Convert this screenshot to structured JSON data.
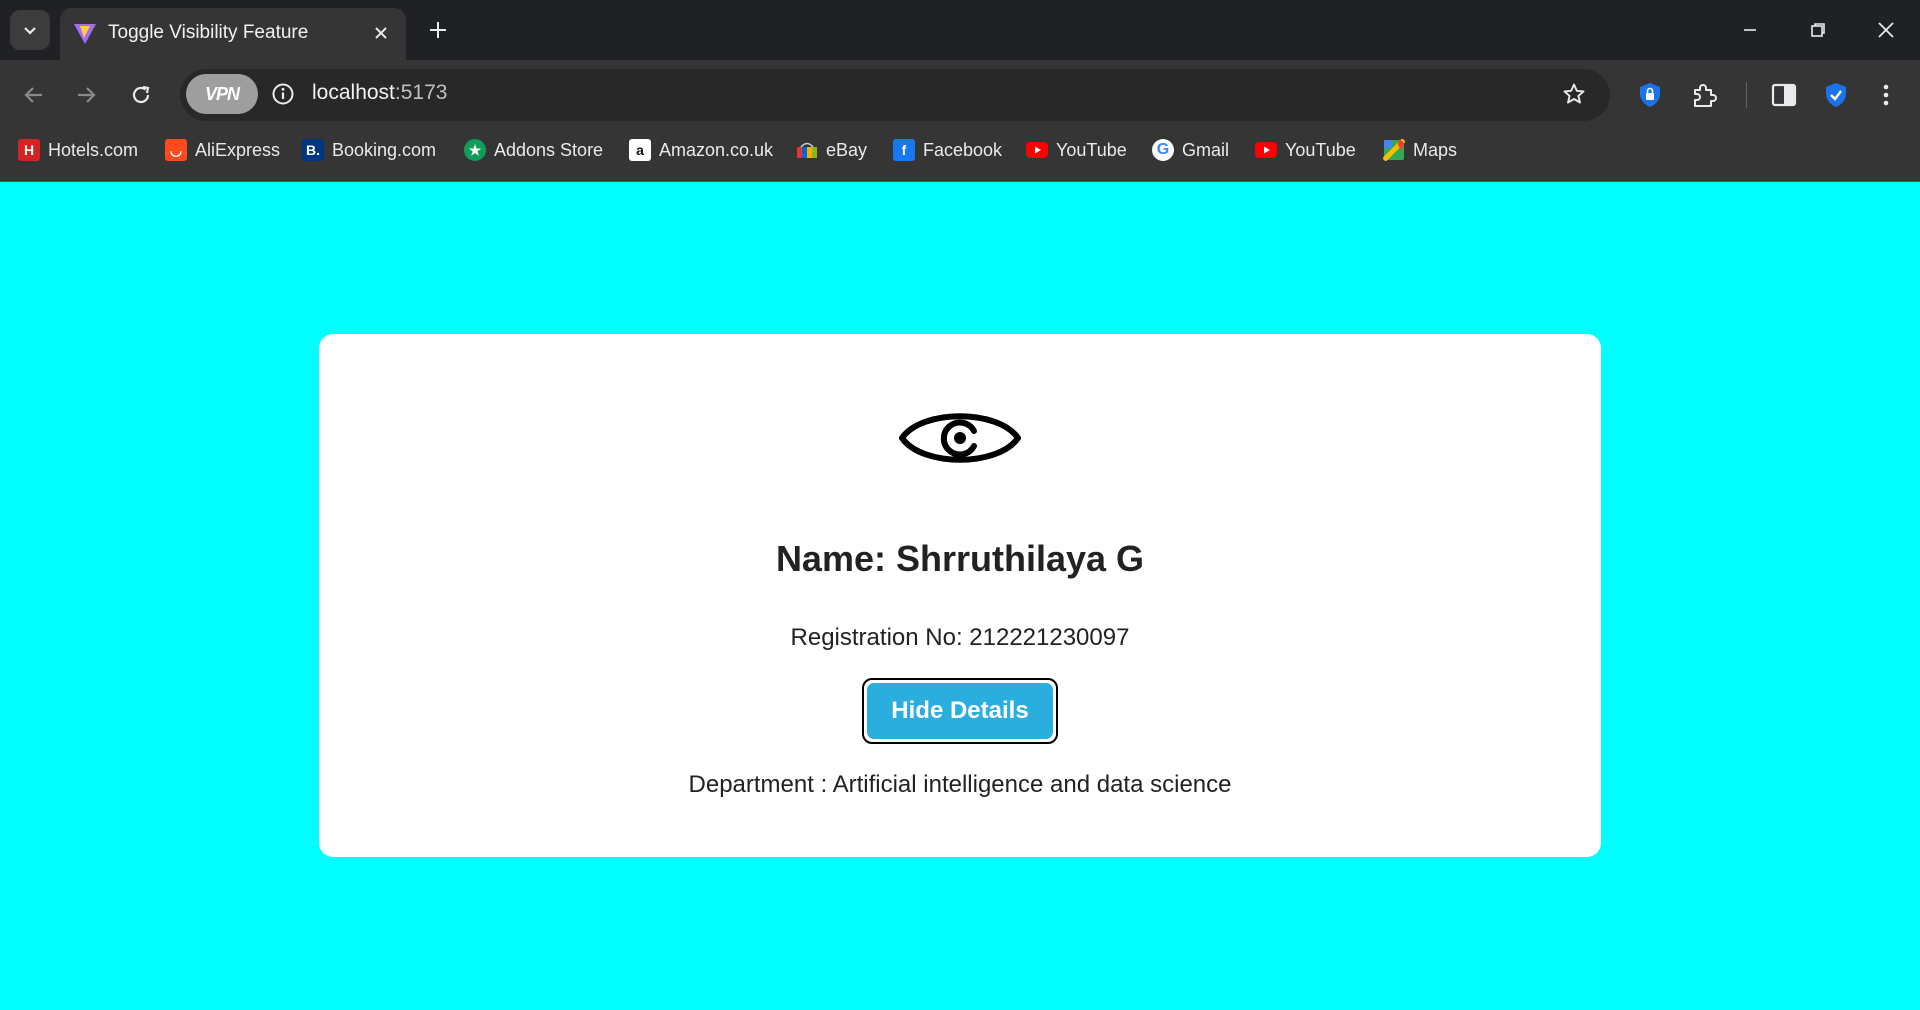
{
  "browser": {
    "tab_title": "Toggle Visibility Feature",
    "url_host": "localhost",
    "url_port": ":5173",
    "vpn_label": "VPN"
  },
  "bookmarks": [
    {
      "label": "Hotels.com",
      "icon": "hotels-icon",
      "color": "#d32323"
    },
    {
      "label": "AliExpress",
      "icon": "aliexpress-icon",
      "color": "#ff4a1c"
    },
    {
      "label": "Booking.com",
      "icon": "booking-icon",
      "color": "#003580"
    },
    {
      "label": "Addons Store",
      "icon": "addons-store-icon",
      "color": "#0f9d58"
    },
    {
      "label": "Amazon.co.uk",
      "icon": "amazon-icon",
      "color": "#ffffff"
    },
    {
      "label": "eBay",
      "icon": "ebay-icon",
      "color": "#e53238"
    },
    {
      "label": "Facebook",
      "icon": "facebook-icon",
      "color": "#1877f2"
    },
    {
      "label": "YouTube",
      "icon": "youtube-icon",
      "color": "#ff0000"
    },
    {
      "label": "Gmail",
      "icon": "google-icon",
      "color": "#ffffff"
    },
    {
      "label": "YouTube",
      "icon": "youtube-icon",
      "color": "#ff0000"
    },
    {
      "label": "Maps",
      "icon": "maps-icon",
      "color": "#34a853"
    }
  ],
  "page": {
    "background": "#00ffff",
    "name_line": "Name: Shrruthilaya G",
    "registration_line": "Registration No: 212221230097",
    "toggle_button_label": "Hide Details",
    "department_line": "Department : Artificial intelligence and data science",
    "button_color": "#2aaede"
  }
}
